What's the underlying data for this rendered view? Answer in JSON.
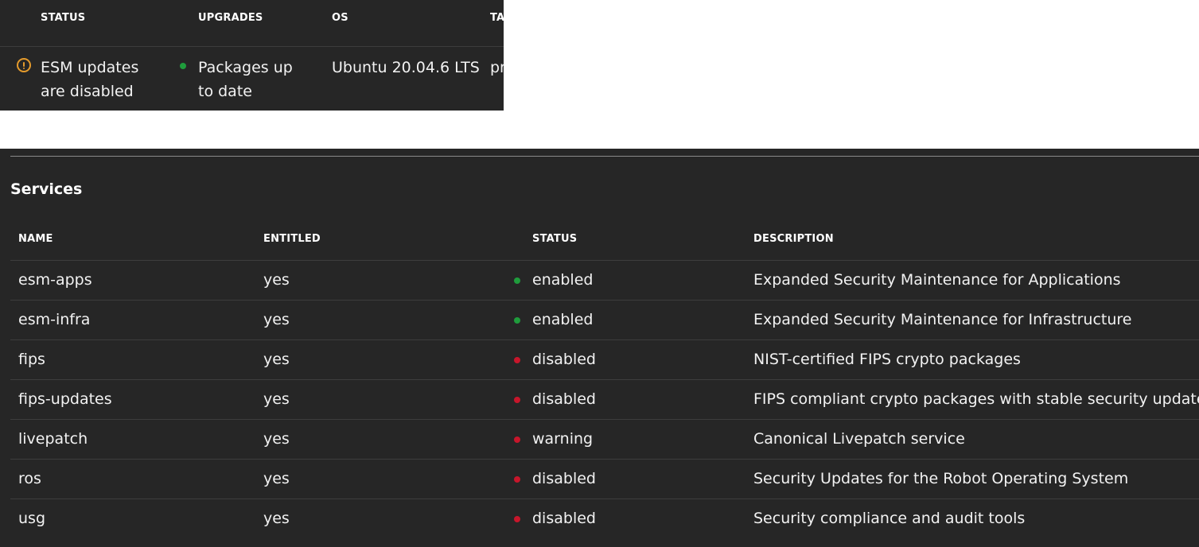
{
  "summary": {
    "headers": {
      "status": "STATUS",
      "upgrades": "UPGRADES",
      "os": "OS",
      "tags": "TAGS"
    },
    "status_line1": "ESM updates",
    "status_line2": "are disabled",
    "upgrades_line1": "Packages up",
    "upgrades_line2": "to date",
    "os": "Ubuntu 20.04.6 LTS",
    "tags": "pro"
  },
  "services": {
    "title": "Services",
    "columns": {
      "name": "NAME",
      "entitled": "ENTITLED",
      "status": "STATUS",
      "description": "DESCRIPTION"
    },
    "rows": [
      {
        "name": "esm-apps",
        "entitled": "yes",
        "status": "enabled",
        "status_color": "#1f9c3c",
        "description": "Expanded Security Maintenance for Applications"
      },
      {
        "name": "esm-infra",
        "entitled": "yes",
        "status": "enabled",
        "status_color": "#1f9c3c",
        "description": "Expanded Security Maintenance for Infrastructure"
      },
      {
        "name": "fips",
        "entitled": "yes",
        "status": "disabled",
        "status_color": "#c7162b",
        "description": "NIST-certified FIPS crypto packages"
      },
      {
        "name": "fips-updates",
        "entitled": "yes",
        "status": "disabled",
        "status_color": "#c7162b",
        "description": "FIPS compliant crypto packages with stable security updates"
      },
      {
        "name": "livepatch",
        "entitled": "yes",
        "status": "warning",
        "status_color": "#c7162b",
        "description": "Canonical Livepatch service"
      },
      {
        "name": "ros",
        "entitled": "yes",
        "status": "disabled",
        "status_color": "#c7162b",
        "description": "Security Updates for the Robot Operating System"
      },
      {
        "name": "usg",
        "entitled": "yes",
        "status": "disabled",
        "status_color": "#c7162b",
        "description": "Security compliance and audit tools"
      }
    ]
  },
  "colors": {
    "panel_bg": "#262626",
    "enabled": "#1f9c3c",
    "disabled": "#c7162b",
    "warning_icon": "#e59b2c"
  },
  "icons": {
    "status_warning": "warning-circle-icon",
    "status_dot": "status-dot-icon"
  }
}
